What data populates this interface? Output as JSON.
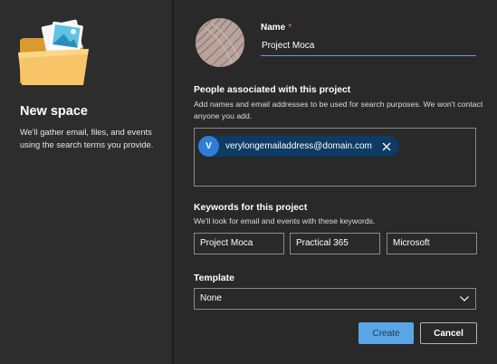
{
  "sidebar": {
    "illustration_icon": "folder-with-photo-icon",
    "title": "New space",
    "description": "We'll gather email, files, and events using the search terms you provide."
  },
  "form": {
    "avatar_icon": "project-pattern-avatar",
    "name": {
      "label": "Name",
      "required_marker": "*",
      "value": "Project Moca"
    },
    "people": {
      "title": "People associated with this project",
      "description": "Add names and email addresses to be used for search purposes. We won't contact anyone you add.",
      "chips": [
        {
          "initial": "V",
          "email": "verylongemailaddress@domain.com",
          "remove_icon": "close-icon"
        }
      ]
    },
    "keywords": {
      "title": "Keywords for this project",
      "description": "We'll look for email and events with these keywords.",
      "values": [
        "Project Moca",
        "Practical 365",
        "Microsoft"
      ]
    },
    "template": {
      "label": "Template",
      "selected": "None",
      "chevron_icon": "chevron-down-icon"
    }
  },
  "actions": {
    "create_label": "Create",
    "cancel_label": "Cancel"
  },
  "colors": {
    "background": "#292929",
    "accent": "#5aa5e6",
    "chip": "#0c3b63",
    "chip_avatar": "#2f7dd6",
    "required": "#f1707b"
  }
}
